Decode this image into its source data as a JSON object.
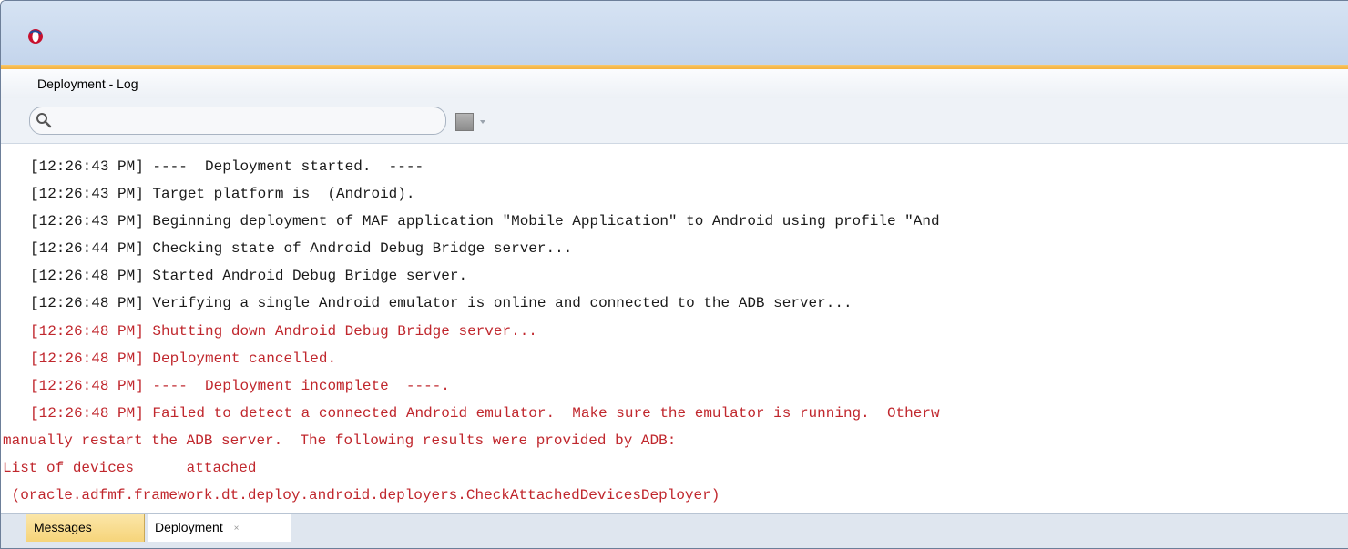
{
  "window": {
    "panel_title": "Deployment - Log"
  },
  "toolbar": {
    "search": {
      "value": "",
      "placeholder": ""
    }
  },
  "log": {
    "lines": [
      {
        "text": "[12:26:43 PM] ----  Deployment started.  ----",
        "color": "#1a1a1a"
      },
      {
        "text": "[12:26:43 PM] Target platform is  (Android).",
        "color": "#1a1a1a"
      },
      {
        "text": "[12:26:43 PM] Beginning deployment of MAF application \"Mobile Application\" to Android using profile \"And",
        "color": "#1a1a1a"
      },
      {
        "text": "[12:26:44 PM] Checking state of Android Debug Bridge server...",
        "color": "#1a1a1a"
      },
      {
        "text": "[12:26:48 PM] Started Android Debug Bridge server.",
        "color": "#1a1a1a"
      },
      {
        "text": "[12:26:48 PM] Verifying a single Android emulator is online and connected to the ADB server...",
        "color": "#1a1a1a"
      },
      {
        "text": "[12:26:48 PM] Shutting down Android Debug Bridge server...",
        "color": "#c0272d"
      },
      {
        "text": "[12:26:48 PM] Deployment cancelled.",
        "color": "#c0272d"
      },
      {
        "text": "[12:26:48 PM] ----  Deployment incomplete  ----.",
        "color": "#c0272d"
      },
      {
        "text": "[12:26:48 PM] Failed to detect a connected Android emulator.  Make sure the emulator is running.  Otherw",
        "color": "#c0272d"
      },
      {
        "text": "manually restart the ADB server.  The following results were provided by ADB:",
        "color": "#c0272d"
      },
      {
        "text": "List of devices      attached",
        "color": "#c0272d"
      },
      {
        "text": " (oracle.adfmf.framework.dt.deploy.android.deployers.CheckAttachedDevicesDeployer)",
        "color": "#c0272d"
      }
    ]
  },
  "tabs": [
    {
      "label": "Messages"
    },
    {
      "label": "Deployment",
      "close": "×"
    }
  ],
  "icons": {
    "app": "oracle-jdeveloper-logo",
    "search": "search-icon",
    "stop": "stop-icon",
    "dropdown": "chevron-down-icon"
  }
}
